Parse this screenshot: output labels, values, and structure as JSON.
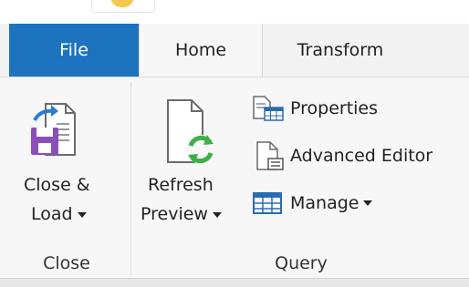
{
  "tabs": {
    "file": "File",
    "home": "Home",
    "transform": "Transform"
  },
  "ribbon": {
    "close_group": {
      "close_load_line1": "Close &",
      "close_load_line2": "Load",
      "label": "Close"
    },
    "query_group": {
      "refresh_line1": "Refresh",
      "refresh_line2": "Preview",
      "properties": "Properties",
      "advanced_editor": "Advanced Editor",
      "manage": "Manage",
      "label": "Query"
    }
  },
  "colors": {
    "file_tab": "#1e73be",
    "refresh_icon": "#3fae49",
    "floppy": "#8b4fb8",
    "arrow": "#2b7bd1"
  },
  "icons": {
    "close_load": "save-close-load-icon",
    "refresh": "refresh-preview-icon",
    "properties": "properties-icon",
    "advanced_editor": "advanced-editor-icon",
    "manage": "manage-table-icon"
  }
}
